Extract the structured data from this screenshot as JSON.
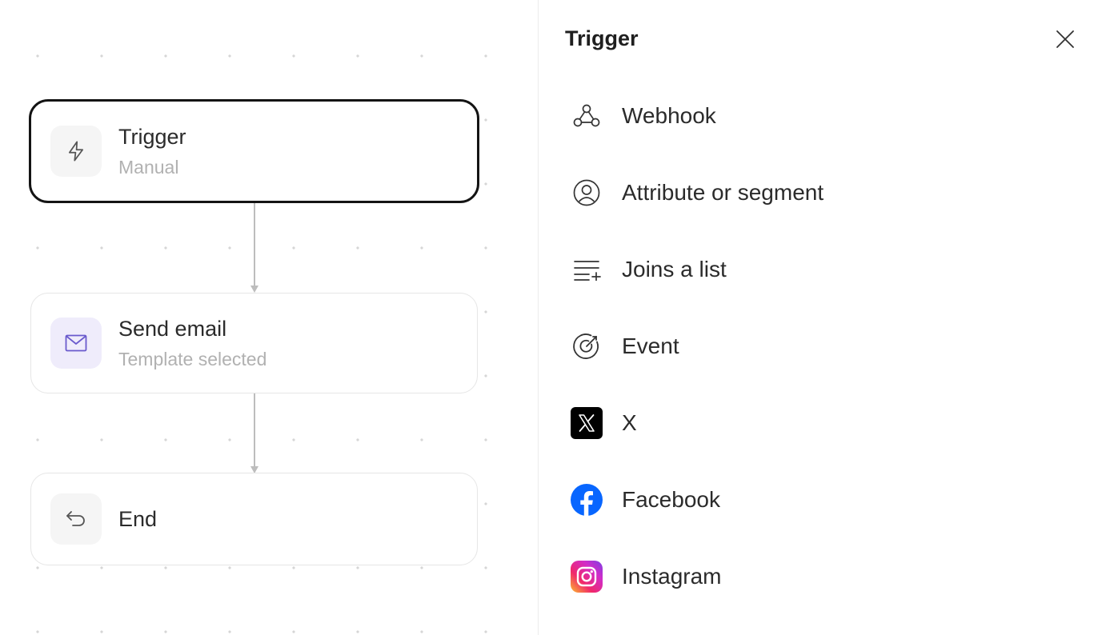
{
  "flow": {
    "nodes": [
      {
        "title": "Trigger",
        "subtitle": "Manual",
        "icon": "lightning-icon"
      },
      {
        "title": "Send email",
        "subtitle": "Template selected",
        "icon": "mail-icon"
      },
      {
        "title": "End",
        "subtitle": "",
        "icon": "return-arrow-icon"
      }
    ]
  },
  "panel": {
    "title": "Trigger",
    "close_icon": "close-icon",
    "options": [
      {
        "label": "Webhook",
        "icon": "webhook-icon"
      },
      {
        "label": "Attribute or segment",
        "icon": "user-circle-icon"
      },
      {
        "label": "Joins a list",
        "icon": "list-add-icon"
      },
      {
        "label": "Event",
        "icon": "target-icon"
      },
      {
        "label": "X",
        "icon": "x-logo-icon"
      },
      {
        "label": "Facebook",
        "icon": "facebook-logo-icon"
      },
      {
        "label": "Instagram",
        "icon": "instagram-logo-icon"
      }
    ]
  },
  "colors": {
    "selected_border": "#141414",
    "email_icon_bg": "#efecfb",
    "email_icon": "#6a5acd",
    "facebook": "#0866ff",
    "x_bg": "#000000"
  }
}
